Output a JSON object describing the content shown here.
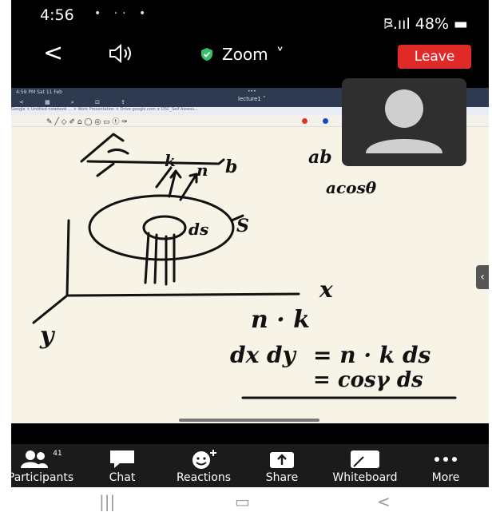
{
  "status_bar": {
    "time": "4:56",
    "notification_icons": "• ·· •",
    "signal_battery": "ཋ.ııl 48% ▬"
  },
  "toolbar": {
    "back_icon": "back-chevron-icon",
    "speaker_icon": "speaker-icon",
    "meeting_title": "Zoom",
    "title_chevron": "˅",
    "leave_label": "Leave"
  },
  "shared_screen": {
    "ipad_status": "4:59 PM  Sat 11 Feb",
    "ipad_dots": "•••",
    "document_title": "lecture1 ˅",
    "ipad_tabs": "Google  ×  Untitled notebook ...  ×  Work Presentation  ×  Drive google com  ×  DSC_Self Assess...",
    "pen_colors": [
      "#e0342a",
      "#1b46c4"
    ],
    "ink_text": {
      "ab": "ab",
      "acosth": "acosθ",
      "b": "b",
      "k": "k",
      "n": "n",
      "ds": "ds",
      "s": "S",
      "x": "x",
      "y": "y",
      "n_dot_k": "n · k",
      "line1_left": "dx dy",
      "line1_right": "= n · k ds",
      "line2": "= cosγ ds"
    }
  },
  "participant_video": {
    "avatar_icon": "person-avatar-icon"
  },
  "bottom_bar": {
    "participants_count": "41",
    "items": [
      {
        "label": "Participants",
        "icon": "participants-icon"
      },
      {
        "label": "Chat",
        "icon": "chat-icon"
      },
      {
        "label": "Reactions",
        "icon": "reactions-icon"
      },
      {
        "label": "Share",
        "icon": "share-icon"
      },
      {
        "label": "Whiteboard",
        "icon": "whiteboard-icon"
      },
      {
        "label": "More",
        "icon": "more-icon"
      }
    ]
  },
  "android_nav": {
    "recents": "|||",
    "home": "▭",
    "back": "<"
  }
}
